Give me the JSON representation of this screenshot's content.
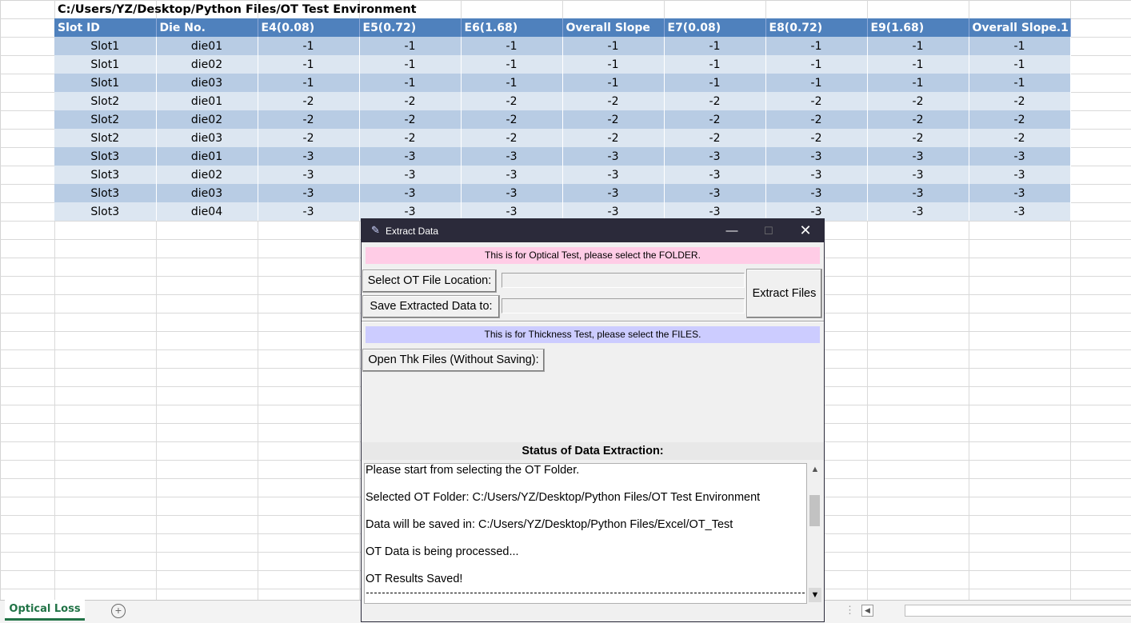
{
  "sheet": {
    "path": "C:/Users/YZ/Desktop/Python Files/OT Test Environment",
    "headers": [
      "Slot ID",
      "Die No.",
      "E4(0.08)",
      "E5(0.72)",
      "E6(1.68)",
      "Overall Slope",
      "E7(0.08)",
      "E8(0.72)",
      "E9(1.68)",
      "Overall Slope.1"
    ],
    "rows": [
      [
        "Slot1",
        "die01",
        "-1",
        "-1",
        "-1",
        "-1",
        "-1",
        "-1",
        "-1",
        "-1"
      ],
      [
        "Slot1",
        "die02",
        "-1",
        "-1",
        "-1",
        "-1",
        "-1",
        "-1",
        "-1",
        "-1"
      ],
      [
        "Slot1",
        "die03",
        "-1",
        "-1",
        "-1",
        "-1",
        "-1",
        "-1",
        "-1",
        "-1"
      ],
      [
        "Slot2",
        "die01",
        "-2",
        "-2",
        "-2",
        "-2",
        "-2",
        "-2",
        "-2",
        "-2"
      ],
      [
        "Slot2",
        "die02",
        "-2",
        "-2",
        "-2",
        "-2",
        "-2",
        "-2",
        "-2",
        "-2"
      ],
      [
        "Slot2",
        "die03",
        "-2",
        "-2",
        "-2",
        "-2",
        "-2",
        "-2",
        "-2",
        "-2"
      ],
      [
        "Slot3",
        "die01",
        "-3",
        "-3",
        "-3",
        "-3",
        "-3",
        "-3",
        "-3",
        "-3"
      ],
      [
        "Slot3",
        "die02",
        "-3",
        "-3",
        "-3",
        "-3",
        "-3",
        "-3",
        "-3",
        "-3"
      ],
      [
        "Slot3",
        "die03",
        "-3",
        "-3",
        "-3",
        "-3",
        "-3",
        "-3",
        "-3",
        "-3"
      ],
      [
        "Slot3",
        "die04",
        "-3",
        "-3",
        "-3",
        "-3",
        "-3",
        "-3",
        "-3",
        "-3"
      ]
    ],
    "active_tab": "Optical Loss",
    "colors": {
      "header_bg": "#4f81bd",
      "row_band_dark": "#b8cce4",
      "row_band_light": "#dce6f1",
      "tab_accent": "#217346"
    }
  },
  "dialog": {
    "title": "Extract Data",
    "icon": "feather-icon",
    "optical_banner": "This is for Optical Test, please select the FOLDER.",
    "select_ot_label": "Select OT File Location:",
    "save_label": "Save Extracted Data to:",
    "ot_location_value": "",
    "save_location_value": "",
    "extract_label": "Extract Files",
    "thickness_banner": "This is for Thickness Test, please select the FILES.",
    "open_thk_label": "Open Thk Files (Without Saving):",
    "status_title": "Status of Data Extraction:",
    "log": [
      "Please start from selecting the OT Folder.",
      "Selected OT Folder: C:/Users/YZ/Desktop/Python Files/OT Test Environment",
      "Data will be saved in: C:/Users/YZ/Desktop/Python Files/Excel/OT_Test",
      "OT Data is being processed...",
      "OT Results Saved!"
    ],
    "colors": {
      "titlebar": "#2b2a3a",
      "optical_banner": "#ffcce6",
      "thickness_banner": "#ccccff"
    }
  }
}
